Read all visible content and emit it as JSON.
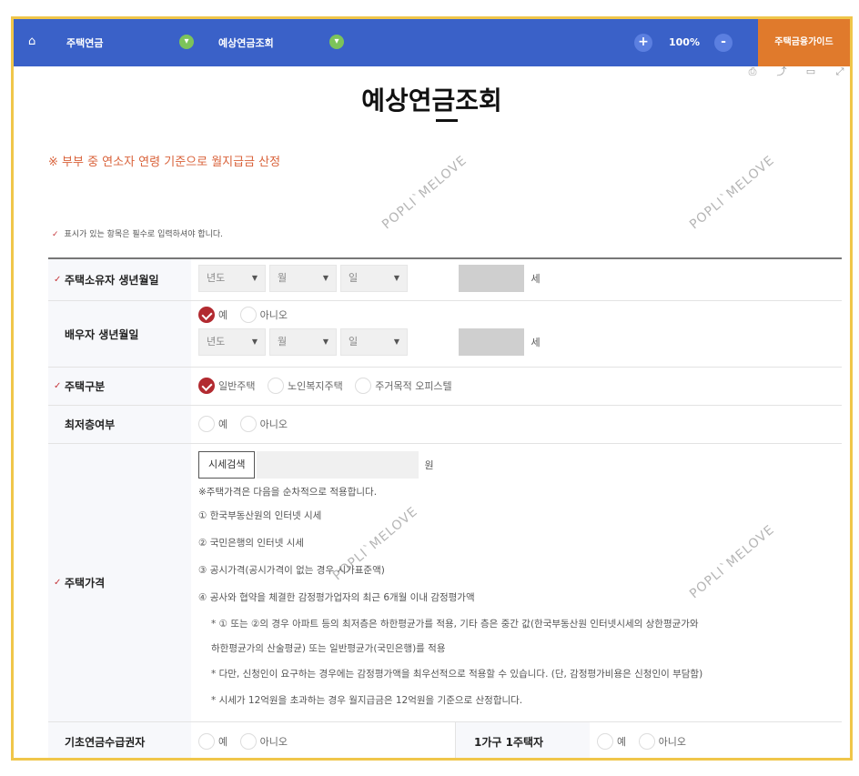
{
  "topbar": {
    "home_icon": "home-icon",
    "crumb1": "주택연금",
    "crumb2": "예상연금조회",
    "zoom": "100%",
    "zoom_in": "+",
    "zoom_out": "-",
    "guide": "주택금융가이드",
    "color_bar": "#3a61c8",
    "color_guide": "#e07a2c"
  },
  "tools": [
    "print-icon",
    "share-icon",
    "bookmark-icon",
    "expand-icon"
  ],
  "page": {
    "title": "예상연금조회",
    "notice": "※ 부부 중 연소자 연령 기준으로 월지급금 산정",
    "required_note": "표시가 있는 항목은 필수로 입력하셔야 합니다.",
    "required_mark": "✓"
  },
  "form": {
    "owner_birth": {
      "label": "주택소유자 생년월일",
      "year": "년도",
      "month": "월",
      "day": "일",
      "unit": "세"
    },
    "spouse_birth": {
      "label": "배우자 생년월일",
      "yes": "예",
      "no": "아니오",
      "year": "년도",
      "month": "월",
      "day": "일",
      "unit": "세"
    },
    "house_type": {
      "label": "주택구분",
      "options": [
        "일반주택",
        "노인복지주택",
        "주거목적 오피스텔"
      ]
    },
    "lowest_floor": {
      "label": "최저층여부",
      "yes": "예",
      "no": "아니오"
    },
    "house_price": {
      "label": "주택가격",
      "search_button": "시세검색",
      "unit": "원",
      "note": "※주택가격은 다음을 순차적으로 적용합니다.",
      "lines": [
        "① 한국부동산원의 인터넷 시세",
        "② 국민은행의 인터넷 시세",
        "③ 공시가격(공시가격이 없는 경우 시가표준액)",
        "④ 공사와 협약을 체결한 감정평가업자의 최근 6개월 이내 감정평가액"
      ],
      "sub_lines": [
        "* ① 또는 ②의 경우 아파트 등의 최저층은 하한평균가를 적용, 기타 층은 중간 값(한국부동산원 인터넷시세의 상한평균가와",
        "하한평균가의 산술평균) 또는 일반평균가(국민은행)를 적용",
        "* 다만, 신청인이 요구하는 경우에는 감정평가액을 최우선적으로 적용할 수 있습니다. (단, 감정평가비용은 신청인이 부담함)",
        "* 시세가 12억원을 초과하는 경우 월지급금은 12억원을 기준으로 산정합니다."
      ]
    },
    "basic_pension": {
      "label": "기초연금수급권자",
      "yes": "예",
      "no": "아니오"
    },
    "single_house": {
      "label": "1가구 1주택자",
      "yes": "예",
      "no": "아니오"
    }
  },
  "watermark": "POPLI`MELOVE"
}
